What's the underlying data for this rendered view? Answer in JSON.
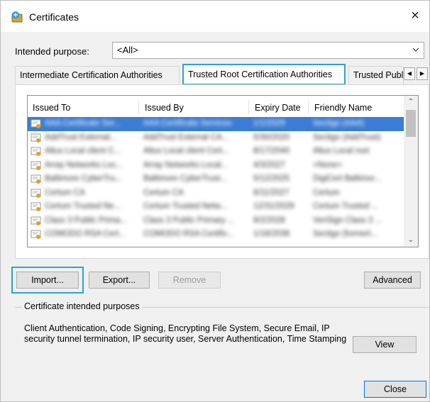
{
  "window": {
    "title": "Certificates",
    "close_glyph": "×"
  },
  "purpose": {
    "label": "Intended purpose:",
    "value": "<All>"
  },
  "tabs": [
    {
      "label": "Intermediate Certification Authorities"
    },
    {
      "label": "Trusted Root Certification Authorities"
    },
    {
      "label": "Trusted Publ"
    }
  ],
  "columns": [
    "Issued To",
    "Issued By",
    "Expiry Date",
    "Friendly Name"
  ],
  "rows": [
    {
      "issued_to": "AAA Certificate Ser...",
      "issued_by": "AAA Certificate Services",
      "expiry": "1/1/2029",
      "friendly": "Sectigo (AAA)"
    },
    {
      "issued_to": "AddTrust External...",
      "issued_by": "AddTrust External CA...",
      "expiry": "5/30/2020",
      "friendly": "Sectigo (AddTrust)"
    },
    {
      "issued_to": "Altus Local client C...",
      "issued_by": "Altus Local client Cert...",
      "expiry": "8/17/2040",
      "friendly": "Altus Local root"
    },
    {
      "issued_to": "Array Networks Loc...",
      "issued_by": "Array Networks Local...",
      "expiry": "4/3/2027",
      "friendly": "<None>"
    },
    {
      "issued_to": "Baltimore CyberTru...",
      "issued_by": "Baltimore CyberTrust...",
      "expiry": "5/12/2025",
      "friendly": "DigiCert Baltimor..."
    },
    {
      "issued_to": "Certum CA",
      "issued_by": "Certum CA",
      "expiry": "6/11/2027",
      "friendly": "Certum"
    },
    {
      "issued_to": "Certum Trusted Ne...",
      "issued_by": "Certum Trusted Netw...",
      "expiry": "12/31/2029",
      "friendly": "Certum Trusted ..."
    },
    {
      "issued_to": "Class 3 Public Prima...",
      "issued_by": "Class 3 Public Primary ...",
      "expiry": "8/2/2028",
      "friendly": "VeriSign Class 3 ..."
    },
    {
      "issued_to": "COMODO RSA Cert...",
      "issued_by": "COMODO RSA Certific...",
      "expiry": "1/18/2038",
      "friendly": "Sectigo (formerl..."
    }
  ],
  "buttons": {
    "import": "Import...",
    "export": "Export...",
    "remove": "Remove",
    "advanced": "Advanced",
    "view": "View",
    "close": "Close"
  },
  "group": {
    "title": "Certificate intended purposes",
    "text": "Client Authentication, Code Signing, Encrypting File System, Secure Email, IP security tunnel termination, IP security user, Server Authentication, Time Stamping"
  },
  "colors": {
    "selection": "#3b7dd4",
    "callout": "#2ea1d4",
    "default_button_border": "#0078d7"
  },
  "icons": [
    "certificates-app-icon",
    "chevron-down-icon",
    "close-icon",
    "certificate-icon"
  ]
}
